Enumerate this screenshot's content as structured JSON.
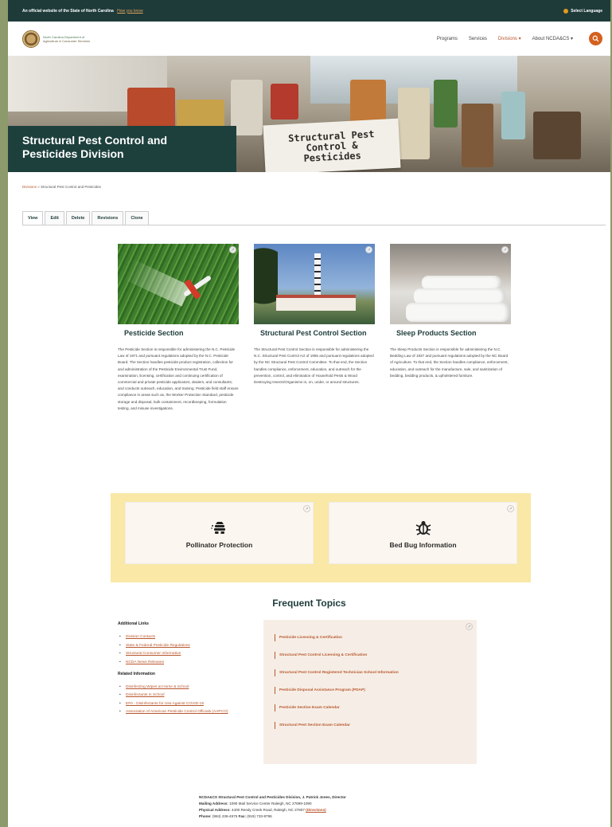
{
  "top_bar": {
    "official_text": "An official website of the State of North Carolina",
    "know_link": "How you know",
    "language_label": "Select Language"
  },
  "header": {
    "logo_line1": "North Carolina Department of",
    "logo_line2": "Agriculture & Consumer Services",
    "nav": [
      "Programs",
      "Services",
      "Divisions",
      "About NCDA&CS"
    ]
  },
  "hero": {
    "title": "Structural Pest Control and Pesticides Division",
    "sign_lines": [
      "Structural Pest",
      "Control &",
      "Pesticides"
    ]
  },
  "breadcrumb": {
    "home": "Divisions",
    "separator": "»",
    "current": "Structural Pest Control and Pesticides"
  },
  "tabs": [
    "View",
    "Edit",
    "Delete",
    "Revisions",
    "Clone"
  ],
  "sections": [
    {
      "title": "Pesticide Section",
      "body": "The Pesticide Section is responsible for administering the N.C. Pesticide Law of 1971 and pursuant regulations adopted by the N.C. Pesticide Board. The Section handles pesticide product registration, collection for and administration of the Pesticide Environmental Trust Fund, examination, licensing, certification and continuing certification of commercial and private pesticide applicators, dealers, and consultants; and conducts outreach, education, and training. Pesticide field staff ensure compliance in areas such as, the Worker Protection Standard, pesticide storage and disposal, bulk containment, recordkeeping, formulation testing, and misuse investigations."
    },
    {
      "title": "Structural Pest Control Section",
      "body": "The Structural Pest Control Section is responsible for administering the N.C. Structural Pest Control Act of 1955 and pursuant regulations adopted by the NC Structural Pest Control Committee. To that end, the Section handles compliance, enforcement, education, and outreach for the prevention, control, and elimination of Household Pests & Wood Destroying Insects/Organisms in, on, under, or around structures."
    },
    {
      "title": "Sleep Products Section",
      "body": "The Sleep Products Section is responsible for administering the N.C. Bedding Law of 1937 and pursuant regulations adopted by the NC Board of Agriculture. To that end, the Section handles compliance, enforcement, education, and outreach for the manufacture, sale, and sanitization of bedding, bedding products, & upholstered furniture."
    }
  ],
  "featured": [
    {
      "label": "Pollinator Protection",
      "icon": "beehive-icon"
    },
    {
      "label": "Bed Bug Information",
      "icon": "bug-icon"
    }
  ],
  "frequent_topics": {
    "title": "Frequent Topics",
    "additional_links_heading": "Additional Links",
    "additional_links": [
      "Division Contacts",
      "State & Federal Pesticide Regulations",
      "Structural Consumer Information",
      "NCDA News Releases"
    ],
    "related_heading": "Related Information",
    "related_links": [
      "Disinfecting Wipes at Home & School",
      "Disinfectants in School",
      "EPA - Disinfectants for Use Against COVID-19",
      "Association of American Pesticide Control Officials (AAPCO)"
    ],
    "topics": [
      "Pesticide Licensing & Certification",
      "Structural Pest Control Licensing & Certification",
      "Structural Pest Control Registered Technician School Information",
      "Pesticide Disposal Assistance Program (PDAP)",
      "Pesticide Section Exam Calendar",
      "Structural Pest Section Exam Calendar"
    ]
  },
  "footer": {
    "org": "NCDA&CS Structural Pest Control and Pesticides Division, J. Patrick Jones, Director",
    "mailing_label": "Mailing Address:",
    "mailing": "1090 Mail Service Center Raleigh, NC 27699-1090",
    "physical_label": "Physical Address:",
    "physical": "4400 Reedy Creek Road, Raleigh, NC 27607",
    "directions": "(Directions)",
    "phone_label": "Phone:",
    "phone": "(984) 236-4575",
    "fax_label": "Fax:",
    "fax": "(919) 733-9796"
  }
}
